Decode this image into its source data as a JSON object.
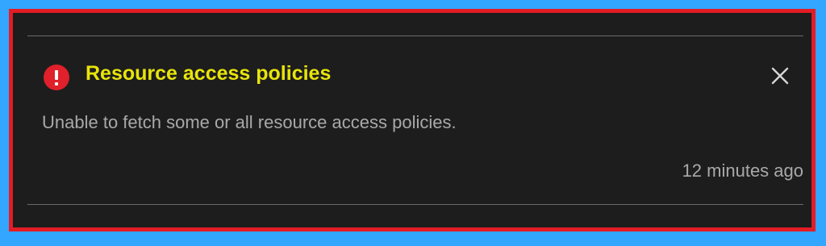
{
  "notification": {
    "icon": "error-icon",
    "title": "Resource access policies",
    "message": "Unable to fetch some or all resource access policies.",
    "timestamp": "12 minutes ago",
    "close_icon": "close-icon"
  },
  "colors": {
    "page_background": "#33a6ff",
    "highlight_border": "#e41c24",
    "panel_background": "#1d1d1d",
    "title_text": "#e8e40a",
    "body_text": "#a9a9a9",
    "error_icon": "#e0202a",
    "divider": "#6a6a6a"
  }
}
